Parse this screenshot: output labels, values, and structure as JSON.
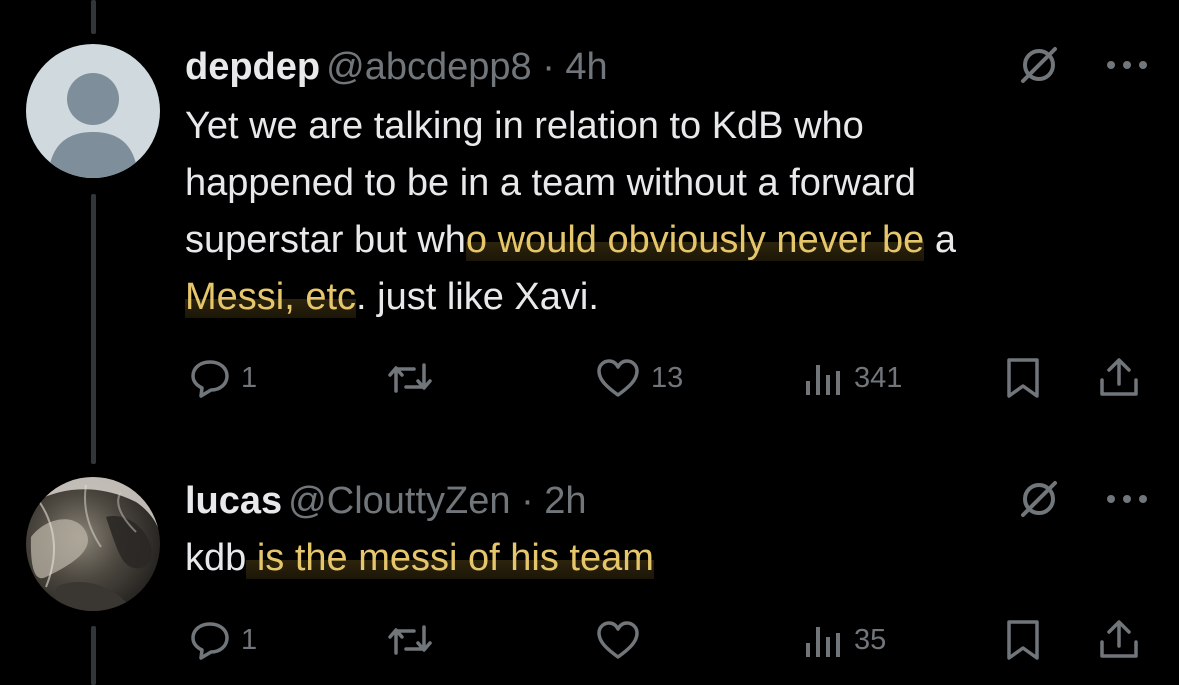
{
  "tweets": [
    {
      "name": "depdep",
      "handle": "@abcdepp8",
      "separator": "·",
      "time": "4h",
      "body": [
        {
          "text": "Yet we are talking in relation to KdB who",
          "hl": false
        },
        {
          "text": "happened to be in a team without a forward",
          "hl": false
        },
        {
          "text": "superstar but wh",
          "hl": false
        },
        {
          "text": "o would obviously never be",
          "hl": true
        },
        {
          "text": " a",
          "hl": false
        },
        {
          "text": "Messi, etc",
          "hl": true
        },
        {
          "text": ". just like Xavi.",
          "hl": false
        }
      ],
      "reply_count": "1",
      "like_count": "13",
      "view_count": "341"
    },
    {
      "name": "lucas",
      "handle": "@ClouttyZen",
      "separator": "·",
      "time": "2h",
      "body": [
        {
          "text": "kdb",
          "hl": false
        },
        {
          "text": " is the messi of his team",
          "hl": true
        }
      ],
      "reply_count": "1",
      "like_count": "",
      "view_count": "35"
    }
  ],
  "icons": {
    "grok": "grok-icon",
    "more": "more-icon",
    "reply": "reply-icon",
    "retweet": "retweet-icon",
    "like": "like-icon",
    "views": "views-icon",
    "bookmark": "bookmark-icon",
    "share": "share-icon"
  },
  "colors": {
    "background": "#000000",
    "text": "#e7e9ea",
    "muted": "#71767b",
    "highlight_text": "#e6c66a"
  }
}
